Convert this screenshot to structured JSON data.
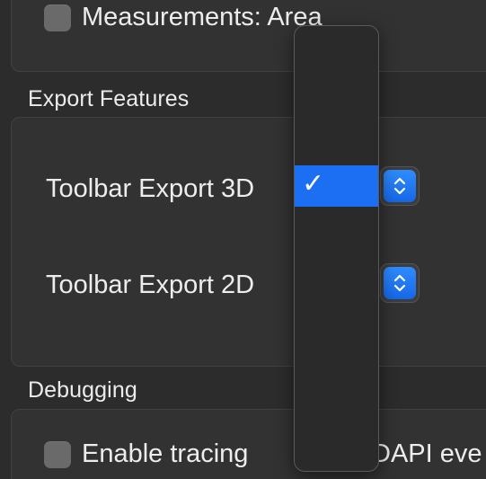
{
  "settings": {
    "measurements_area_label": "Measurements: Area",
    "sections": {
      "export_title": "Export Features",
      "debug_title": "Debugging"
    },
    "export": {
      "toolbar_3d_label": "Toolbar Export 3D",
      "toolbar_2d_label": "Toolbar Export 2D"
    },
    "debug": {
      "tracing_label": "Enable tracing",
      "tracing_suffix": "DAPI eve"
    }
  },
  "dropdown": {
    "selected_check": "✓"
  },
  "colors": {
    "accent": "#1c6ff2",
    "background": "#2c2c2c",
    "group_background": "#323232"
  }
}
